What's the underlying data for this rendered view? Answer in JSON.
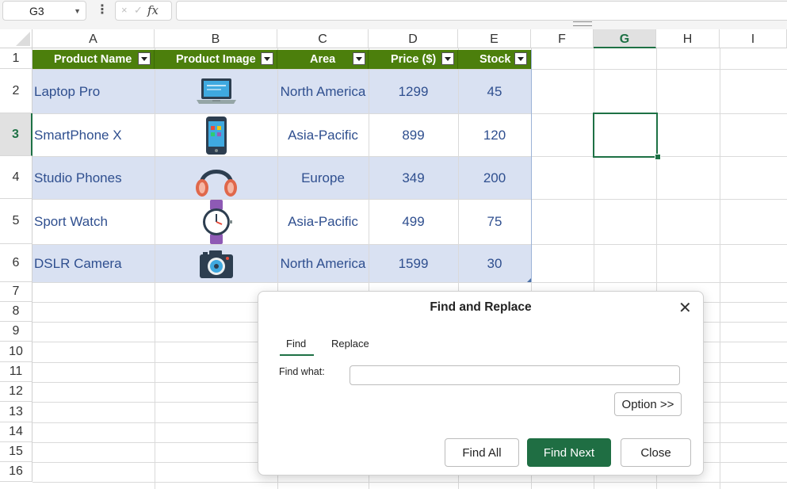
{
  "formula_bar": {
    "name_box": "G3",
    "formula": "",
    "fx_label": "fx",
    "cancel_icon": "×",
    "enter_icon": "✓",
    "more_icon": "⋮"
  },
  "columns": [
    "A",
    "B",
    "C",
    "D",
    "E",
    "F",
    "G",
    "H",
    "I"
  ],
  "selected_column": "G",
  "rows": [
    "1",
    "2",
    "3",
    "4",
    "5",
    "6",
    "7",
    "8",
    "9",
    "10",
    "11",
    "12",
    "13",
    "14",
    "15",
    "16"
  ],
  "selected_row": "3",
  "table": {
    "headers": [
      "Product Name",
      "Product Image",
      "Area",
      "Price ($)",
      "Stock"
    ],
    "header_color": "#4c7f0c",
    "band_color": "#d9e1f2",
    "text_color": "#2f4f8f",
    "rows": [
      {
        "name": "Laptop Pro",
        "image": "laptop-icon",
        "area": "North America",
        "price": "1299",
        "stock": "45"
      },
      {
        "name": "SmartPhone X",
        "image": "smartphone-icon",
        "area": "Asia-Pacific",
        "price": "899",
        "stock": "120"
      },
      {
        "name": "Studio Phones",
        "image": "headphones-icon",
        "area": "Europe",
        "price": "349",
        "stock": "200"
      },
      {
        "name": "Sport Watch",
        "image": "watch-icon",
        "area": "Asia-Pacific",
        "price": "499",
        "stock": "75"
      },
      {
        "name": "DSLR Camera",
        "image": "camera-icon",
        "area": "North America",
        "price": "1599",
        "stock": "30"
      }
    ]
  },
  "dialog": {
    "title": "Find and Replace",
    "close_icon": "✕",
    "tabs": [
      {
        "label": "Find",
        "active": true
      },
      {
        "label": "Replace",
        "active": false
      }
    ],
    "find_label": "Find what:",
    "find_value": "",
    "option_button": "Option >>",
    "find_all_button": "Find All",
    "find_next_button": "Find Next",
    "close_button": "Close",
    "accent_color": "#1f6e43"
  }
}
